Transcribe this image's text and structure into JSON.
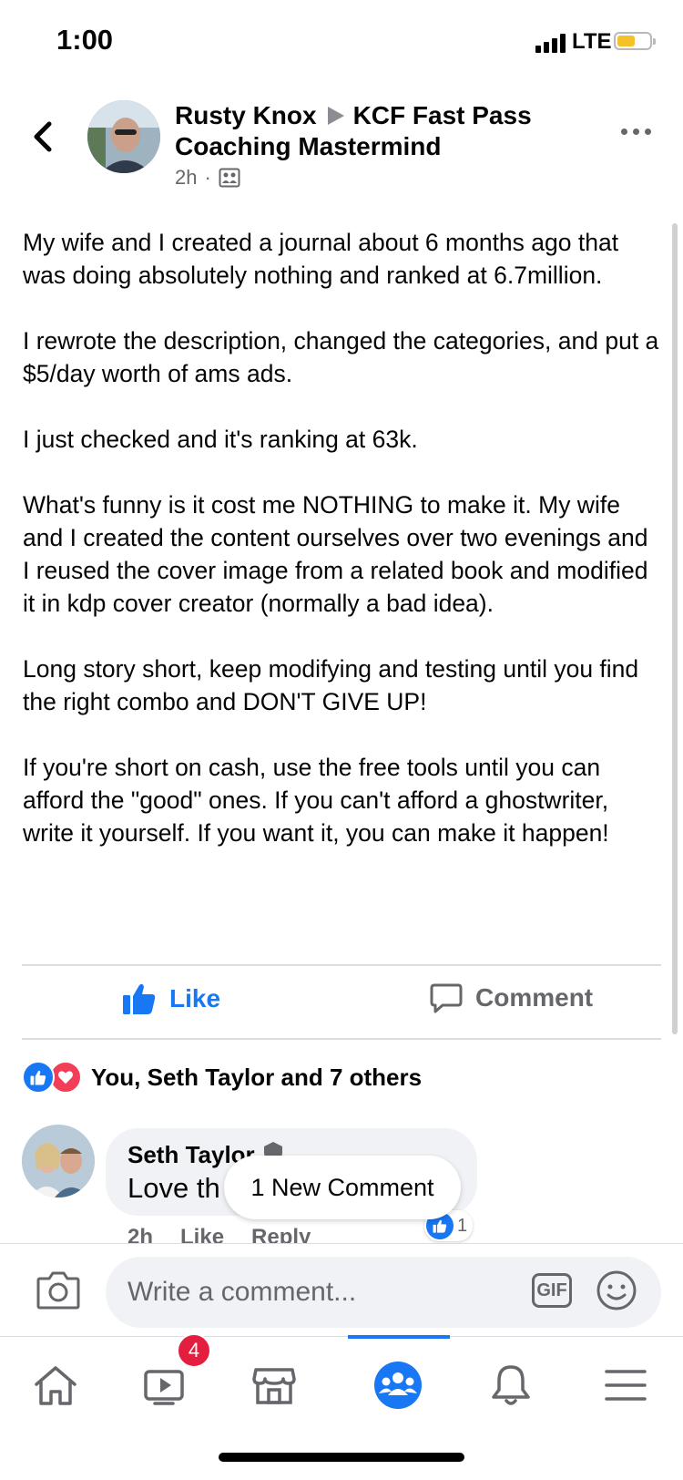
{
  "status_bar": {
    "time": "1:00",
    "network": "LTE"
  },
  "post": {
    "author": "Rusty Knox",
    "group": "KCF Fast Pass Coaching Mastermind",
    "time": "2h",
    "separator": "·",
    "paragraphs": [
      "My wife and I created a journal about 6 months ago that was doing absolutely nothing and ranked at 6.7million.",
      "I rewrote the description, changed the categories, and put a $5/day worth of ams ads.",
      "I just checked and it's ranking at 63k.",
      "What's funny is it cost me NOTHING to make it. My wife and I created the content ourselves over two evenings and I reused the cover image from a related book and modified it in kdp cover creator (normally a bad idea).",
      "Long story short, keep modifying and testing until you find the right combo and DON'T GIVE UP!",
      "If you're short on cash, use the free tools until you can afford the \"good\" ones. If you can't afford a ghostwriter, write it yourself. If you want it, you can make it happen!"
    ]
  },
  "actions": {
    "like_label": "Like",
    "comment_label": "Comment"
  },
  "reactions": {
    "summary": "You, Seth Taylor and 7 others"
  },
  "comment": {
    "author": "Seth Taylor",
    "text": "Love th",
    "time": "2h",
    "like_label": "Like",
    "reply_label": "Reply",
    "reaction_count": "1"
  },
  "new_comment_pill": "1 New Comment",
  "composer": {
    "placeholder": "Write a comment...",
    "gif_label": "GIF"
  },
  "tabbar": {
    "watch_badge": "4"
  },
  "colors": {
    "accent": "#1877f2",
    "love": "#f33e58",
    "badge": "#e41e3f",
    "muted": "#65676b"
  }
}
